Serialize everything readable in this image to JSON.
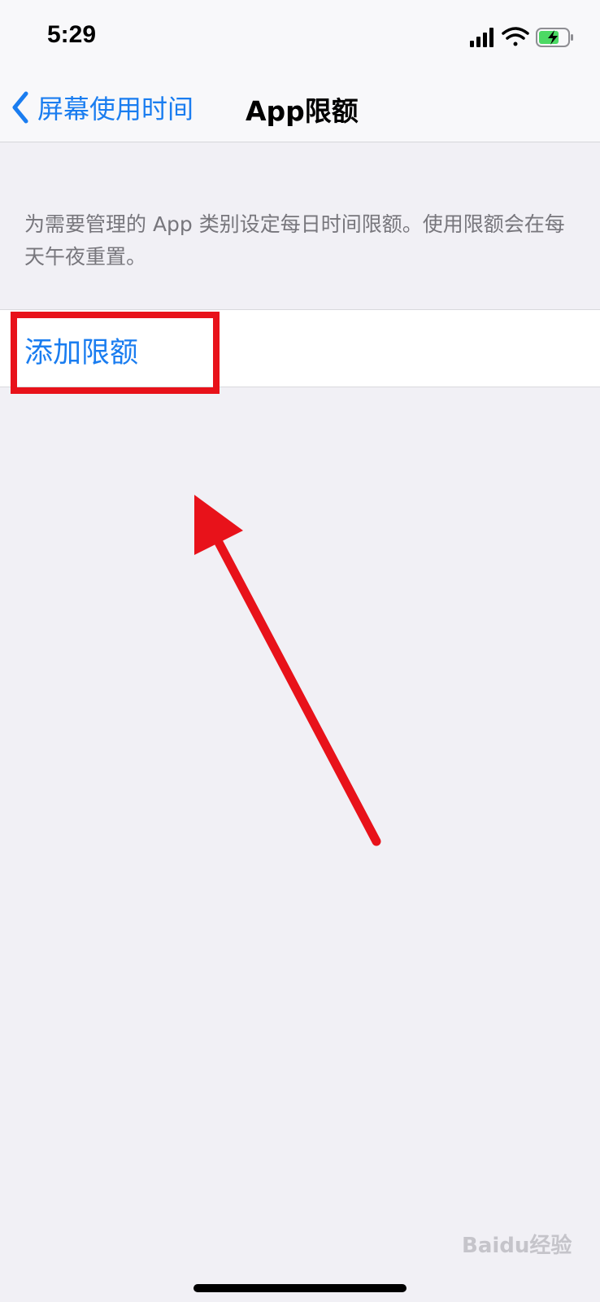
{
  "status_bar": {
    "time": "5:29"
  },
  "nav": {
    "back_label": "屏幕使用时间",
    "title": "App限额"
  },
  "section": {
    "description": "为需要管理的 App 类别设定每日时间限额。使用限额会在每天午夜重置。"
  },
  "limits": {
    "add_label": "添加限额"
  },
  "watermark": {
    "text": "Baidu经验"
  },
  "colors": {
    "accent": "#1a7df0",
    "annotation": "#e8121a",
    "background": "#f1f0f5",
    "battery": "#4cd964"
  },
  "icons": {
    "back": "chevron-left-icon",
    "signal": "cellular-signal-icon",
    "wifi": "wifi-icon",
    "battery": "battery-charging-icon"
  }
}
